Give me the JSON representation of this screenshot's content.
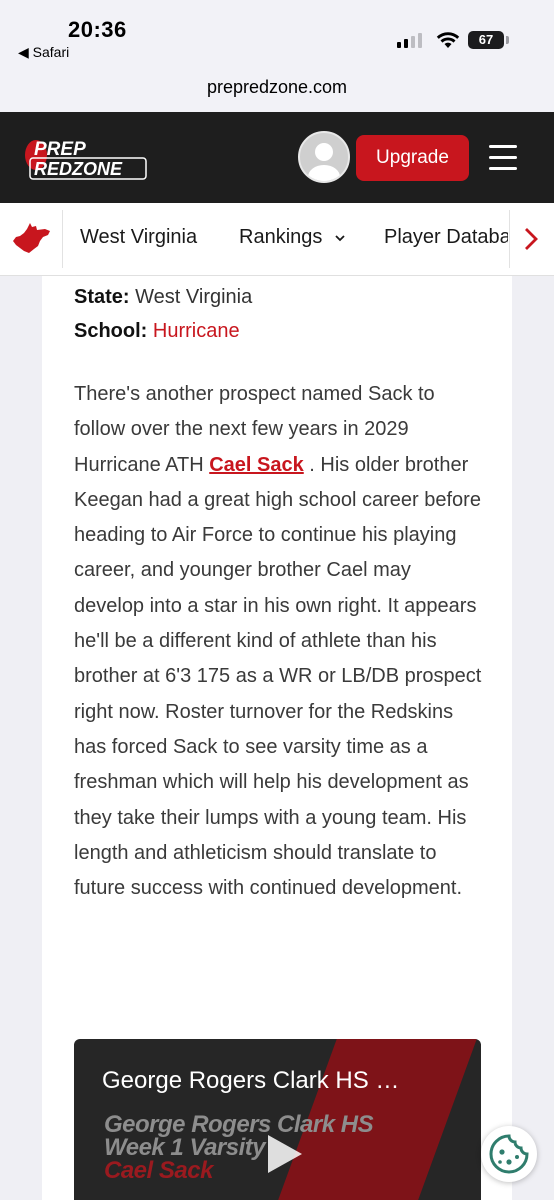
{
  "status_bar": {
    "time": "20:36",
    "back_app": "◀ Safari",
    "battery": "67"
  },
  "browser": {
    "url": "prepredzone.com"
  },
  "header": {
    "logo_top": "PREP",
    "logo_bottom": "REDZONE",
    "upgrade_label": "Upgrade"
  },
  "nav": {
    "items": [
      {
        "label": "West Virginia"
      },
      {
        "label": "Rankings"
      },
      {
        "label": "Player Database"
      }
    ]
  },
  "profile": {
    "state_label": "State:",
    "state_value": "West Virginia",
    "school_label": "School:",
    "school_value": "Hurricane"
  },
  "article": {
    "text_before": "There's another prospect named Sack to follow over the next few years in 2029 Hurricane ATH ",
    "link_text": "Cael Sack",
    "text_after": " . His older brother Keegan had a great high school career before heading to Air Force to continue his playing career, and younger brother Cael may develop into a star in his own right. It appears he'll be a different kind of athlete than his brother at 6'3 175 as a WR or LB/DB prospect right now. Roster turnover for the Redskins has forced Sack to see varsity time as a freshman which will help his development as they take their lumps with a young team. His length and athleticism should translate to future success with continued development."
  },
  "video": {
    "title": "George Rogers Clark HS …",
    "thumb_line1": "George Rogers Clark HS",
    "thumb_line2": "Week 1 Varsity",
    "thumb_line3": "Cael Sack"
  },
  "colors": {
    "brand_red": "#c8161e",
    "header_bg": "#1e1e1e"
  }
}
